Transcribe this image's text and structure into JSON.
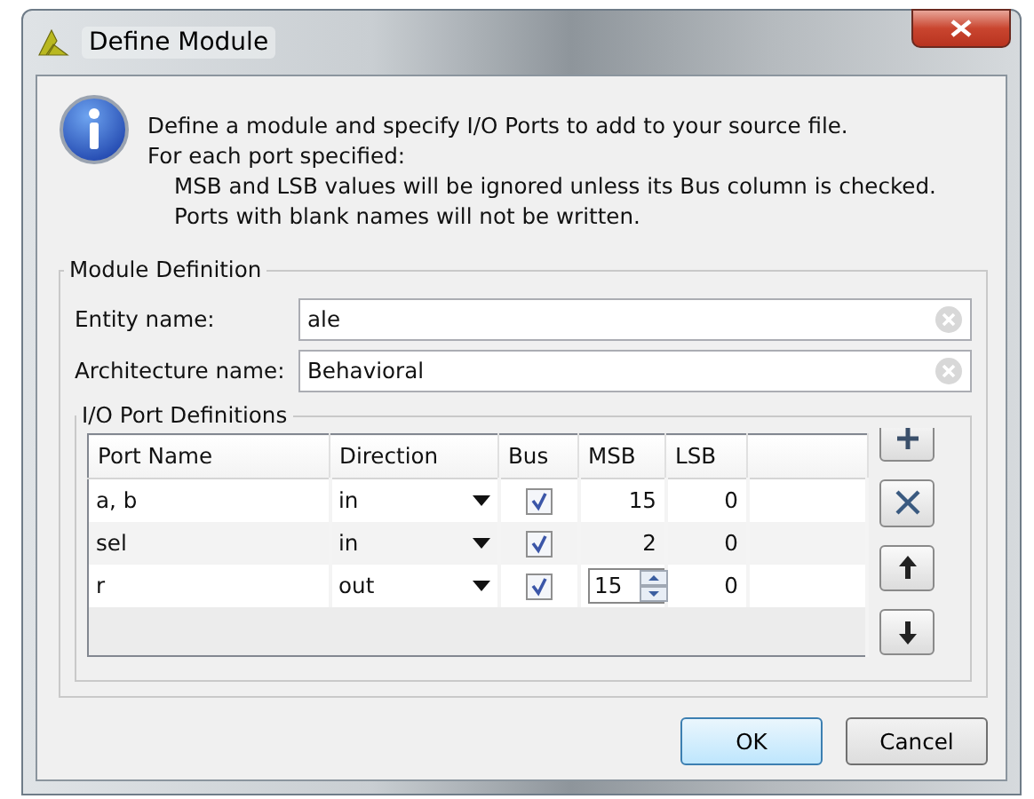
{
  "window": {
    "title": "Define Module"
  },
  "info": {
    "lines": [
      "Define a module and specify I/O Ports to add to your source file.",
      "For each port specified:",
      "MSB and LSB values will be ignored unless its Bus column is checked.",
      "Ports with blank names will not be written."
    ]
  },
  "module_definition": {
    "title": "Module Definition",
    "fields": [
      {
        "label": "Entity name:",
        "value": "ale"
      },
      {
        "label": "Architecture name:",
        "value": "Behavioral"
      }
    ],
    "io_ports": {
      "title": "I/O Port Definitions",
      "columns": [
        "Port Name",
        "Direction",
        "Bus",
        "MSB",
        "LSB"
      ],
      "rows": [
        {
          "port_name": "a, b",
          "direction": "in",
          "bus": true,
          "msb": "15",
          "lsb": "0",
          "msb_editing": false
        },
        {
          "port_name": "sel",
          "direction": "in",
          "bus": true,
          "msb": "2",
          "lsb": "0",
          "msb_editing": false
        },
        {
          "port_name": "r",
          "direction": "out",
          "bus": true,
          "msb": "15",
          "lsb": "0",
          "msb_editing": true
        }
      ],
      "side_buttons": [
        {
          "kind": "add"
        },
        {
          "kind": "remove"
        },
        {
          "kind": "up"
        },
        {
          "kind": "down"
        }
      ]
    }
  },
  "buttons": [
    {
      "label": "OK",
      "default": true
    },
    {
      "label": "Cancel",
      "default": false
    }
  ]
}
